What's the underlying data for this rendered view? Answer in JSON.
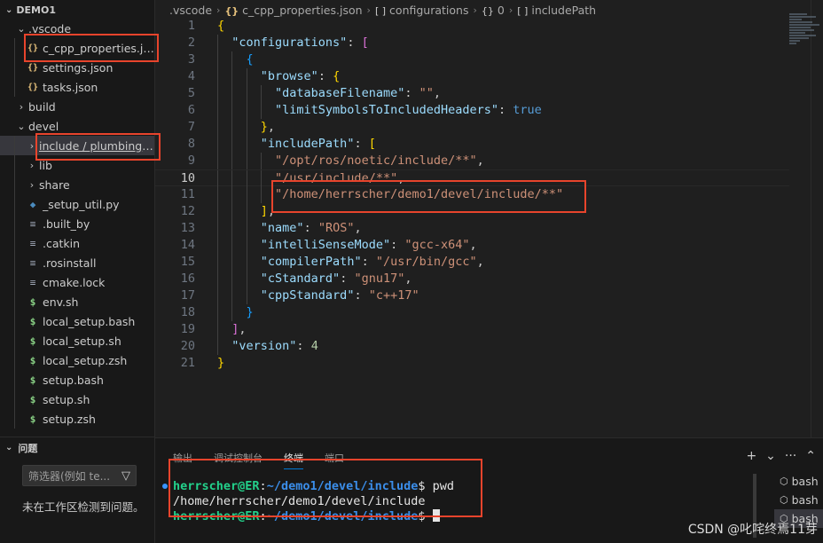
{
  "explorer": {
    "title": "DEMO1",
    "items": [
      {
        "label": ".vscode",
        "depth": 0,
        "chevron": "expanded",
        "icon": ""
      },
      {
        "label": "c_cpp_properties.json",
        "depth": 1,
        "chevron": "",
        "icon": "{}"
      },
      {
        "label": "settings.json",
        "depth": 1,
        "chevron": "",
        "icon": "{}"
      },
      {
        "label": "tasks.json",
        "depth": 1,
        "chevron": "",
        "icon": "{}"
      },
      {
        "label": "build",
        "depth": 0,
        "chevron": "collapsed",
        "icon": ""
      },
      {
        "label": "devel",
        "depth": 0,
        "chevron": "expanded",
        "icon": ""
      },
      {
        "label": "include / plumbing_pub_sub",
        "depth": 1,
        "chevron": "collapsed",
        "icon": "",
        "selected": true
      },
      {
        "label": "lib",
        "depth": 1,
        "chevron": "collapsed",
        "icon": ""
      },
      {
        "label": "share",
        "depth": 1,
        "chevron": "collapsed",
        "icon": ""
      },
      {
        "label": "_setup_util.py",
        "depth": 1,
        "chevron": "",
        "icon": "py"
      },
      {
        "label": ".built_by",
        "depth": 1,
        "chevron": "",
        "icon": "lines"
      },
      {
        "label": ".catkin",
        "depth": 1,
        "chevron": "",
        "icon": "lines"
      },
      {
        "label": ".rosinstall",
        "depth": 1,
        "chevron": "",
        "icon": "lines"
      },
      {
        "label": "cmake.lock",
        "depth": 1,
        "chevron": "",
        "icon": "lines"
      },
      {
        "label": "env.sh",
        "depth": 1,
        "chevron": "",
        "icon": "$"
      },
      {
        "label": "local_setup.bash",
        "depth": 1,
        "chevron": "",
        "icon": "$"
      },
      {
        "label": "local_setup.sh",
        "depth": 1,
        "chevron": "",
        "icon": "$"
      },
      {
        "label": "local_setup.zsh",
        "depth": 1,
        "chevron": "",
        "icon": "$"
      },
      {
        "label": "setup.bash",
        "depth": 1,
        "chevron": "",
        "icon": "$"
      },
      {
        "label": "setup.sh",
        "depth": 1,
        "chevron": "",
        "icon": "$"
      },
      {
        "label": "setup.zsh",
        "depth": 1,
        "chevron": "",
        "icon": "$"
      }
    ]
  },
  "problems": {
    "title": "问题",
    "filter_placeholder": "筛选器(例如 te...",
    "message": "未在工作区检测到问题。"
  },
  "breadcrumbs": [
    ".vscode",
    "c_cpp_properties.json",
    "configurations",
    "0",
    "includePath"
  ],
  "editor": {
    "active_line": 10,
    "lines": [
      [
        [
          "br1",
          "{"
        ]
      ],
      [
        [
          "sp",
          "  "
        ],
        [
          "k",
          "\"configurations\""
        ],
        [
          "p",
          ": "
        ],
        [
          "br2",
          "["
        ]
      ],
      [
        [
          "sp",
          "    "
        ],
        [
          "br3",
          "{"
        ]
      ],
      [
        [
          "sp",
          "      "
        ],
        [
          "k",
          "\"browse\""
        ],
        [
          "p",
          ": "
        ],
        [
          "br1",
          "{"
        ]
      ],
      [
        [
          "sp",
          "        "
        ],
        [
          "k",
          "\"databaseFilename\""
        ],
        [
          "p",
          ": "
        ],
        [
          "s",
          "\"\""
        ],
        [
          "p",
          ","
        ]
      ],
      [
        [
          "sp",
          "        "
        ],
        [
          "k",
          "\"limitSymbolsToIncludedHeaders\""
        ],
        [
          "p",
          ": "
        ],
        [
          "b",
          "true"
        ]
      ],
      [
        [
          "sp",
          "      "
        ],
        [
          "br1",
          "}"
        ],
        [
          "p",
          ","
        ]
      ],
      [
        [
          "sp",
          "      "
        ],
        [
          "k",
          "\"includePath\""
        ],
        [
          "p",
          ": "
        ],
        [
          "br1",
          "["
        ]
      ],
      [
        [
          "sp",
          "        "
        ],
        [
          "s",
          "\"/opt/ros/noetic/include/**\""
        ],
        [
          "p",
          ","
        ]
      ],
      [
        [
          "sp",
          "        "
        ],
        [
          "s",
          "\"/usr/include/**\""
        ],
        [
          "p",
          ","
        ]
      ],
      [
        [
          "sp",
          "        "
        ],
        [
          "s",
          "\"/home/herrscher/demo1/devel/include/**\""
        ]
      ],
      [
        [
          "sp",
          "      "
        ],
        [
          "br1",
          "]"
        ],
        [
          "p",
          ","
        ]
      ],
      [
        [
          "sp",
          "      "
        ],
        [
          "k",
          "\"name\""
        ],
        [
          "p",
          ": "
        ],
        [
          "s",
          "\"ROS\""
        ],
        [
          "p",
          ","
        ]
      ],
      [
        [
          "sp",
          "      "
        ],
        [
          "k",
          "\"intelliSenseMode\""
        ],
        [
          "p",
          ": "
        ],
        [
          "s",
          "\"gcc-x64\""
        ],
        [
          "p",
          ","
        ]
      ],
      [
        [
          "sp",
          "      "
        ],
        [
          "k",
          "\"compilerPath\""
        ],
        [
          "p",
          ": "
        ],
        [
          "s",
          "\"/usr/bin/gcc\""
        ],
        [
          "p",
          ","
        ]
      ],
      [
        [
          "sp",
          "      "
        ],
        [
          "k",
          "\"cStandard\""
        ],
        [
          "p",
          ": "
        ],
        [
          "s",
          "\"gnu17\""
        ],
        [
          "p",
          ","
        ]
      ],
      [
        [
          "sp",
          "      "
        ],
        [
          "k",
          "\"cppStandard\""
        ],
        [
          "p",
          ": "
        ],
        [
          "s",
          "\"c++17\""
        ]
      ],
      [
        [
          "sp",
          "    "
        ],
        [
          "br3",
          "}"
        ]
      ],
      [
        [
          "sp",
          "  "
        ],
        [
          "br2",
          "]"
        ],
        [
          "p",
          ","
        ]
      ],
      [
        [
          "sp",
          "  "
        ],
        [
          "k",
          "\"version\""
        ],
        [
          "p",
          ": "
        ],
        [
          "n",
          "4"
        ]
      ],
      [
        [
          "br1",
          "}"
        ]
      ]
    ]
  },
  "panel": {
    "tabs": [
      "输出",
      "调试控制台",
      "终端",
      "端口"
    ],
    "active_tab": 2,
    "actions": [
      "+",
      "⌄",
      "···",
      "⌃"
    ]
  },
  "terminal": {
    "lines": [
      {
        "user": "herrscher@ER",
        "colon": ":",
        "path": "~/demo1/devel/include",
        "prompt": "$ ",
        "cmd": "pwd",
        "dot": true
      },
      {
        "output": "/home/herrscher/demo1/devel/include"
      },
      {
        "user": "herrscher@ER",
        "colon": ":",
        "path": "~/demo1/devel/include",
        "prompt": "$ ",
        "cmd": "",
        "cursor": true
      }
    ],
    "sessions": [
      "bash",
      "bash",
      "bash"
    ]
  },
  "watermark": "CSDN @叱咤终焉11芽",
  "colors": {
    "annotation_red": "#e8442c",
    "accent": "#0078d4"
  }
}
